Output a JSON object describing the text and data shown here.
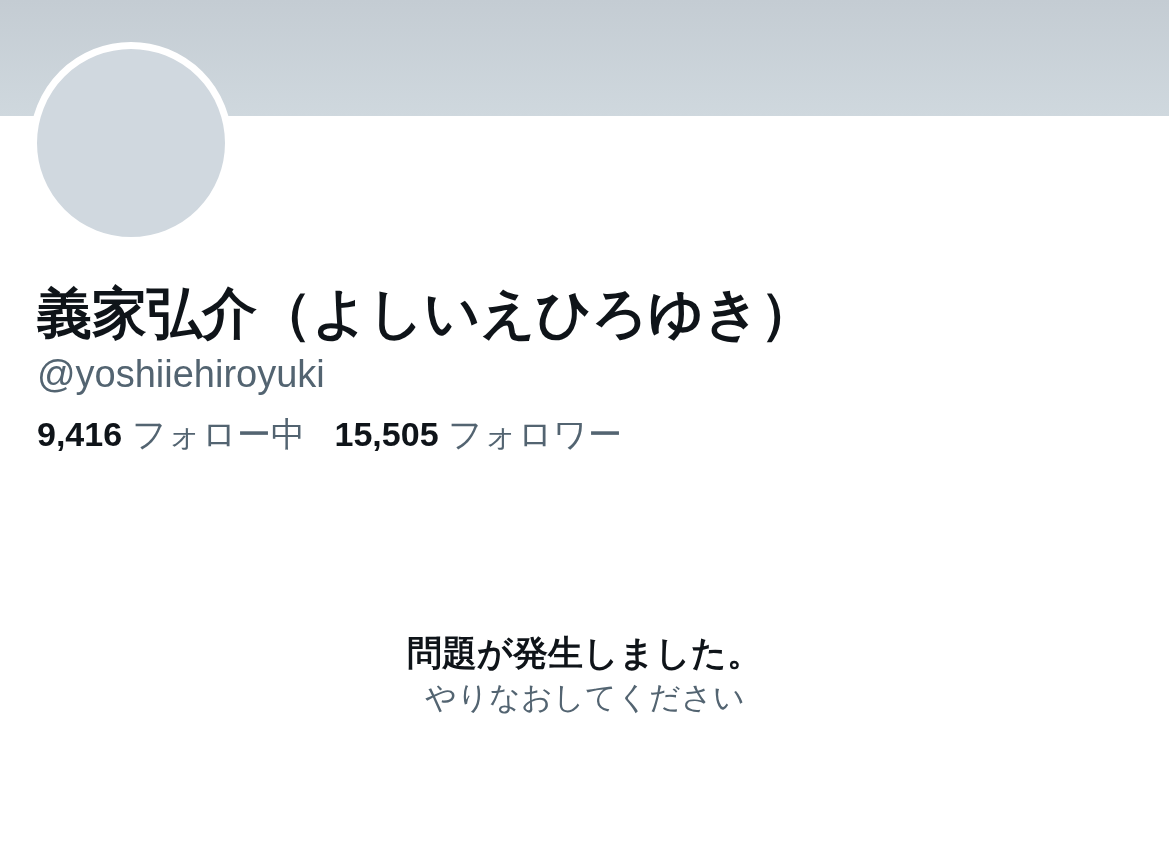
{
  "profile": {
    "name": "義家弘介（よしいえひろゆき）",
    "handle": "@yoshiiehiroyuki",
    "stats": [
      {
        "count": "9,416",
        "label": "フォロー中"
      },
      {
        "count": "15,505",
        "label": "フォロワー"
      }
    ]
  },
  "error": {
    "title": "問題が発生しました。",
    "message": "やりなおしてください"
  }
}
